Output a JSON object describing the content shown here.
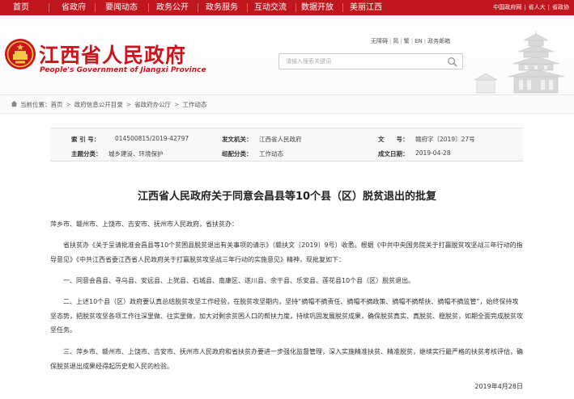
{
  "nav": {
    "items": [
      "首页",
      "省政府",
      "要闻动态",
      "政务公开",
      "政务服务",
      "互动交流",
      "数据开放",
      "美丽江西"
    ],
    "right_links": [
      "中国政府网",
      "省人大",
      "省政协"
    ]
  },
  "header": {
    "title": "江西省人民政府",
    "subtitle": "People's Government of Jiangxi Province",
    "util_links": [
      "无障碍",
      "简",
      "繁",
      "EN",
      "政务邮箱"
    ],
    "search_placeholder": "请输入搜索关键词"
  },
  "breadcrumb": {
    "label": "当前位置：",
    "items": [
      "首页",
      "政府信息公开目录",
      "省政府办公厅",
      "工作动态"
    ]
  },
  "info": {
    "index_label": "索 引 号：",
    "index_value": "014500815/2019-42797",
    "issuer_label": "发文机关：",
    "issuer_value": "江西省人民政府",
    "docno_label": "文　　号：",
    "docno_value": "赣府字〔2019〕27号",
    "topic_label": "主题分类：",
    "topic_value": "城乡建设、环境保护",
    "category_label": "组配分类：",
    "category_value": "工作动态",
    "date_label": "成文日期：",
    "date_value": "2019-04-28"
  },
  "doc": {
    "title": "江西省人民政府关于同意会昌县等10个县（区）脱贫退出的批复",
    "salutation": "萍乡市、赣州市、上饶市、吉安市、抚州市人民政府，省扶贫办：",
    "paragraphs": [
      "省扶贫办《关于呈请批准会昌县等10个贫困县脱贫退出有关事项的请示》（赣扶文〔2019〕9号）收悉。根据《中共中央国务院关于打赢脱贫攻坚战三年行动的指导意见》《中共江西省委江西省人民政府关于打赢脱贫攻坚战三年行动的实施意见》精神，现批复如下：",
      "一、同意会昌县、寻乌县、安远县、上犹县、石城县、南康区、遂川县、余干县、乐安县、莲花县10个县（区）脱贫退出。",
      "二、上述10个县（区）政府要认真总结脱贫攻坚工作经验，在脱贫攻坚期内，坚持“摘帽不摘责任、摘帽不摘政策、摘帽不摘帮扶、摘帽不摘监管”，始终保持攻坚态势，把脱贫攻坚各项工作往深里做、往实里做，加大对剩余贫困人口的帮扶力度，持续巩固发展脱贫成果，确保脱贫真实、真脱贫、稳脱贫，如期全面完成脱贫攻坚任务。",
      "三、萍乡市、赣州市、上饶市、吉安市、抚州市人民政府和省扶贫办要进一步强化监督管理，深入实施精准扶贫、精准脱贫，继续实行最严格的扶贫考核评估，确保脱贫退出成果经得起历史和人民的检验。"
    ],
    "date": "2019年4月28日"
  },
  "colors": {
    "brand_red": "#c0161e"
  }
}
